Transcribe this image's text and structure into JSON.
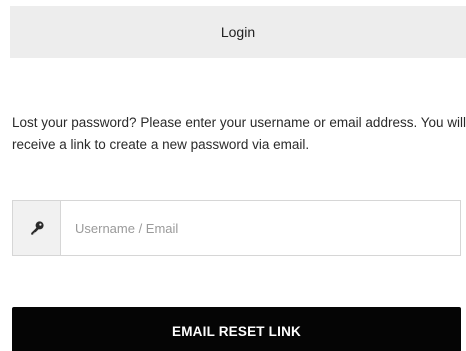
{
  "login_tab": {
    "label": "Login"
  },
  "instructions": {
    "text": "Lost your password? Please enter your username or email address. You will receive a link to create a new password via email."
  },
  "username_field": {
    "icon": "key-icon",
    "value": "",
    "placeholder": "Username / Email"
  },
  "reset_button": {
    "label": "EMAIL RESET LINK"
  },
  "colors": {
    "tab_background": "#ededed",
    "button_background": "#050505",
    "button_text": "#ffffff",
    "addon_background": "#f1f1f1",
    "border": "#d6d6d6"
  }
}
